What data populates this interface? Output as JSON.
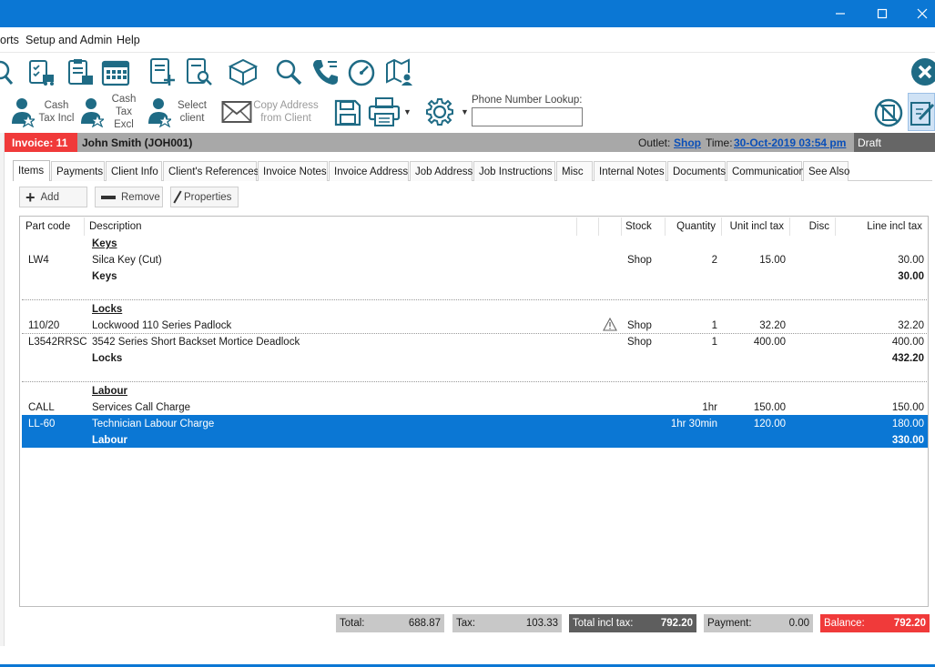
{
  "menu": {
    "items": [
      "orts",
      "Setup and Admin",
      "Help"
    ]
  },
  "toolbar2": {
    "cash_tax_incl": [
      "Cash",
      "Tax Incl"
    ],
    "cash_tax_excl": [
      "Cash",
      "Tax",
      "Excl"
    ],
    "select_client": [
      "Select",
      "client"
    ],
    "copy_address": [
      "Copy Address",
      "from Client"
    ],
    "phone_lookup_label": "Phone Number Lookup:",
    "phone_lookup_value": ""
  },
  "invoice_bar": {
    "invoice": "Invoice: 11",
    "client": "John Smith (JOH001)",
    "outlet_label": "Outlet:",
    "outlet": "Shop",
    "time_label": "Time:",
    "time": "30-Oct-2019 03:54 pm",
    "status": "Draft"
  },
  "tabs": [
    "Items",
    "Payments",
    "Client Info",
    "Client's References",
    "Invoice Notes",
    "Invoice Address",
    "Job Address",
    "Job Instructions",
    "Misc",
    "Internal Notes",
    "Documents",
    "Communication",
    "See Also"
  ],
  "actions": {
    "add": "Add",
    "remove": "Remove",
    "properties": "Properties"
  },
  "grid": {
    "headers": {
      "part_code": "Part code",
      "description": "Description",
      "stock": "Stock",
      "quantity": "Quantity",
      "unit_incl_tax": "Unit incl tax",
      "disc": "Disc",
      "line_incl_tax": "Line incl tax"
    },
    "groups": [
      {
        "name": "Keys",
        "rows": [
          {
            "part": "LW4",
            "desc": "Silca Key (Cut)",
            "stock": "Shop",
            "qty": "2",
            "unit": "15.00",
            "disc": "",
            "line": "30.00",
            "warn": false
          }
        ],
        "subtotal_label": "Keys",
        "subtotal": "30.00"
      },
      {
        "name": "Locks",
        "rows": [
          {
            "part": "110/20",
            "desc": "Lockwood 110 Series Padlock",
            "stock": "Shop",
            "qty": "1",
            "unit": "32.20",
            "disc": "",
            "line": "32.20",
            "warn": true
          },
          {
            "part": "L3542RRSC",
            "desc": "3542 Series Short Backset Mortice Deadlock",
            "stock": "Shop",
            "qty": "1",
            "unit": "400.00",
            "disc": "",
            "line": "400.00",
            "warn": false
          }
        ],
        "subtotal_label": "Locks",
        "subtotal": "432.20"
      },
      {
        "name": "Labour",
        "rows": [
          {
            "part": "CALL",
            "desc": "Services Call Charge",
            "stock": "",
            "qty": "1hr",
            "unit": "150.00",
            "disc": "",
            "line": "150.00",
            "warn": false
          },
          {
            "part": "LL-60",
            "desc": "Technician Labour Charge",
            "stock": "",
            "qty": "1hr 30min",
            "unit": "120.00",
            "disc": "",
            "line": "180.00",
            "warn": false
          }
        ],
        "subtotal_label": "Labour",
        "subtotal": "330.00"
      }
    ]
  },
  "totals": {
    "total_label": "Total:",
    "total": "688.87",
    "tax_label": "Tax:",
    "tax": "103.33",
    "total_incl_label": "Total incl tax:",
    "total_incl": "792.20",
    "payment_label": "Payment:",
    "payment": "0.00",
    "balance_label": "Balance:",
    "balance": "792.20"
  },
  "colors": {
    "accent": "#0b77d4",
    "icon": "#1f6b85",
    "alert": "#f03a3a",
    "link": "#0a4fb8"
  },
  "icons": [
    "search-person-icon",
    "delivery-checklist-icon",
    "shop-clipboard-icon",
    "calendar-icon",
    "add-document-icon",
    "search-document-icon",
    "box-icon",
    "magnifier-icon",
    "phone-icon",
    "gauge-icon",
    "map-person-icon",
    "close-circle-icon"
  ]
}
